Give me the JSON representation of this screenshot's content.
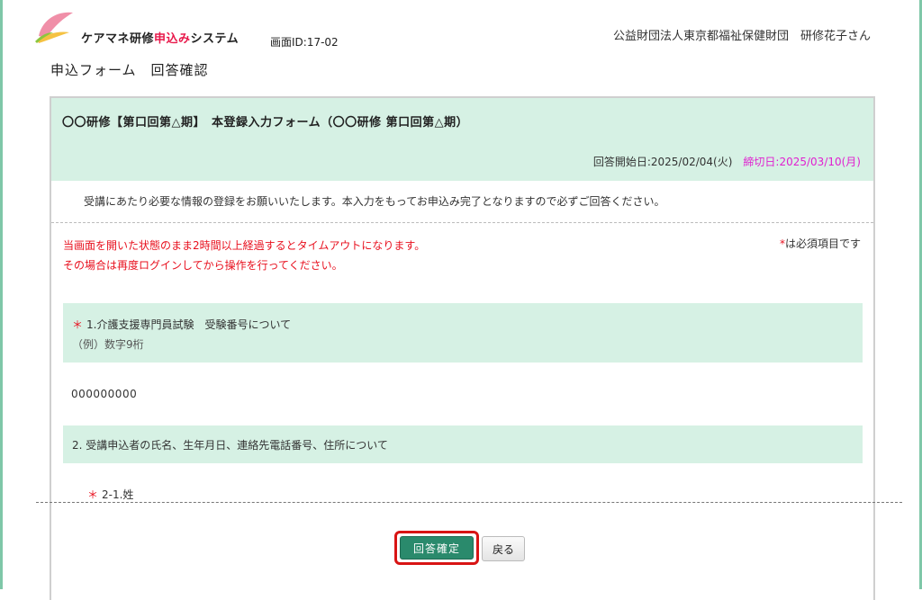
{
  "header": {
    "app_title_prefix": "ケアマネ研修",
    "app_title_highlight": "申込み",
    "app_title_suffix": "システム",
    "screen_id": "画面ID:17-02",
    "org_user": "公益財団法人東京都福祉保健財団　研修花子さん",
    "page_title": "申込フォーム　回答確認"
  },
  "form": {
    "title": "〇〇研修【第口回第△期】　本登録入力フォーム（〇〇研修 第口回第△期）",
    "start_date": "回答開始日:2025/02/04(火)",
    "end_date": "締切日:2025/03/10(月)",
    "intro": "受講にあたり必要な情報の登録をお願いいたします。本入力をもってお申込み完了となりますので必ずご回答ください。",
    "warning_line1": "当画面を開いた状態のまま2時間以上経過するとタイムアウトになります。",
    "warning_line2": "その場合は再度ログインしてから操作を行ってください。",
    "required_star": "*",
    "required_note": "は必須項目です"
  },
  "questions": [
    {
      "star": "＊",
      "label": "1.介護支援専門員試験　受験番号について",
      "example": "（例）数字9桁",
      "answer": "000000000"
    },
    {
      "label": "2. 受講申込者の氏名、生年月日、連絡先電話番号、住所について",
      "sub_star": "＊",
      "sub_label": "2-1.姓"
    }
  ],
  "buttons": {
    "confirm": "回答確定",
    "back": "戻る"
  },
  "colors": {
    "accent_green": "#2a8a6c",
    "panel_green": "#d6f1e4",
    "warning_red": "#e8101e",
    "deadline_magenta": "#e020d0",
    "highlight_border": "#d81414"
  }
}
